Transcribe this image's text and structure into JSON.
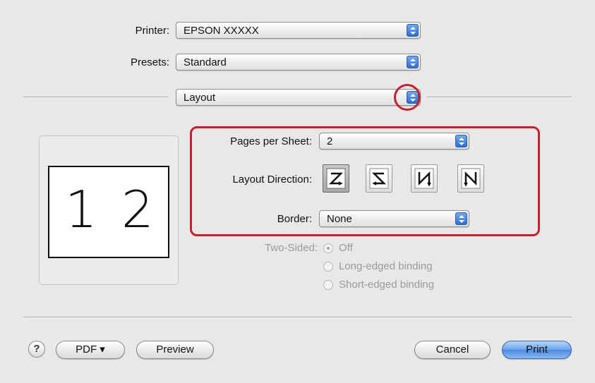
{
  "printer": {
    "label": "Printer:",
    "value": "EPSON XXXXX"
  },
  "presets": {
    "label": "Presets:",
    "value": "Standard"
  },
  "panel": {
    "value": "Layout"
  },
  "preview": {
    "page1": "1",
    "page2": "2"
  },
  "pages_per_sheet": {
    "label": "Pages per Sheet:",
    "value": "2"
  },
  "layout_direction": {
    "label": "Layout Direction:",
    "options": [
      {
        "icon": "z-order-left-right-icon",
        "selected": true
      },
      {
        "icon": "reverse-z-order-icon",
        "selected": false
      },
      {
        "icon": "n-order-top-bottom-icon",
        "selected": false
      },
      {
        "icon": "reverse-n-order-icon",
        "selected": false
      }
    ]
  },
  "border": {
    "label": "Border:",
    "value": "None"
  },
  "two_sided": {
    "label": "Two-Sided:",
    "options": [
      "Off",
      "Long-edged binding",
      "Short-edged binding"
    ],
    "selected": "Off"
  },
  "footer": {
    "help": "?",
    "pdf": "PDF ▾",
    "preview": "Preview",
    "cancel": "Cancel",
    "print": "Print"
  },
  "colors": {
    "highlight": "#c8202a",
    "accent": "#4b89e0"
  }
}
